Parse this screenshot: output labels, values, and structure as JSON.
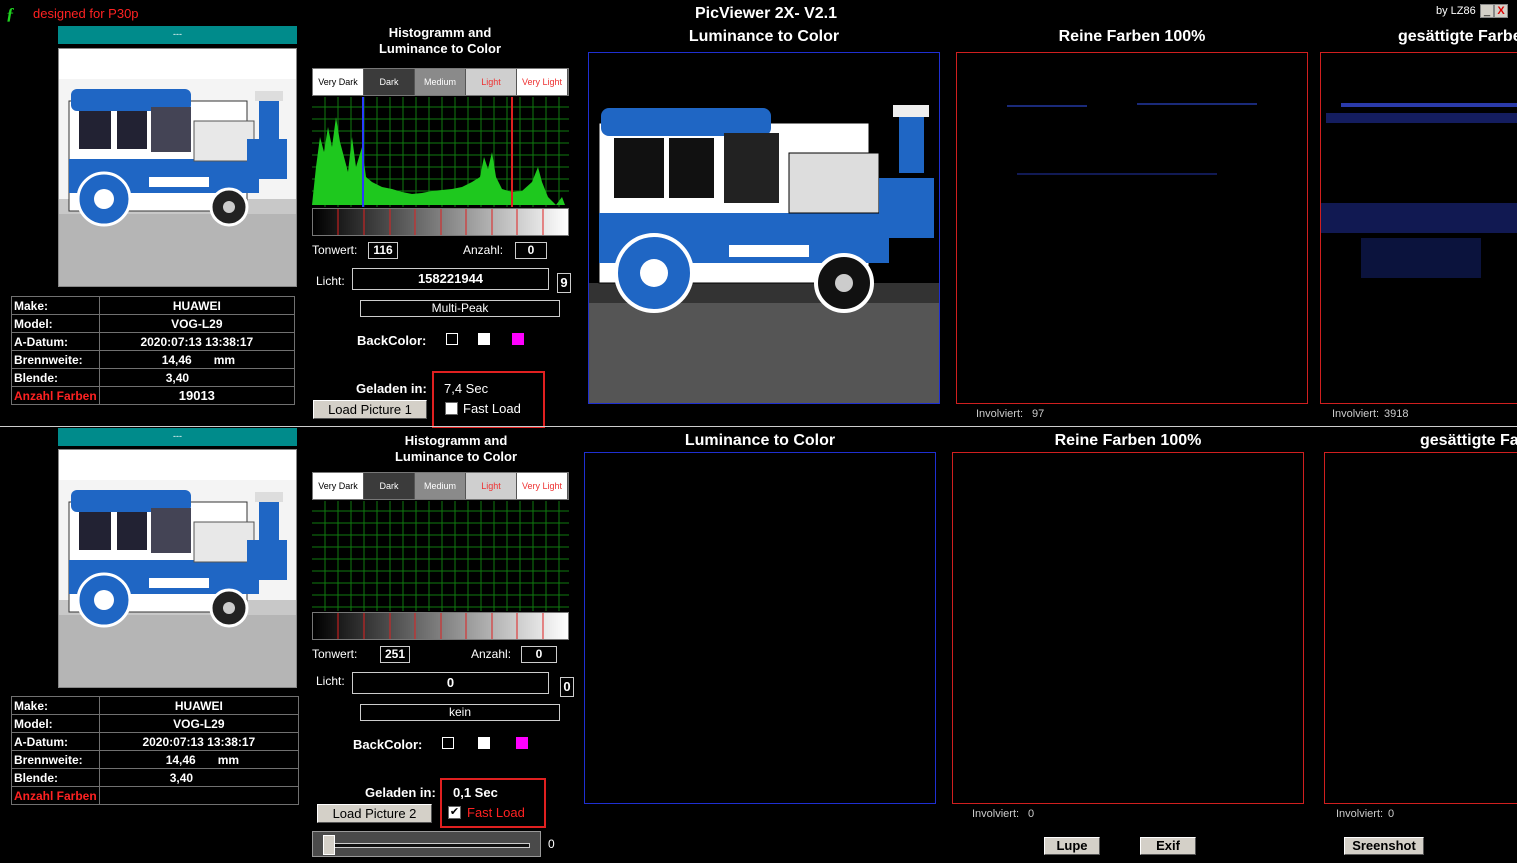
{
  "app": {
    "logo": "ƒ",
    "designed_for": "designed for P30p",
    "title": "PicViewer 2X- V2.1",
    "by": "by LZ86",
    "minimize": "_",
    "close": "X"
  },
  "panel1": {
    "thumb_bar": "---",
    "exif": {
      "make_label": "Make:",
      "make": "HUAWEI",
      "model_label": "Model:",
      "model": "VOG-L29",
      "date_label": "A-Datum:",
      "date": "2020:07:13 13:38:17",
      "focal_label": "Brennweite:",
      "focal": "14,46",
      "focal_unit": "mm",
      "aperture_label": "Blende:",
      "aperture": "3,40",
      "colors_label": "Anzahl Farben",
      "colors": "19013"
    },
    "hist_title": "Histogramm and\nLuminance to Color",
    "tones": [
      "Very Dark",
      "Dark",
      "Medium",
      "Light",
      "Very Light"
    ],
    "tonwert_label": "Tonwert:",
    "tonwert": "116",
    "anzahl_label": "Anzahl:",
    "anzahl": "0",
    "licht_label": "Licht:",
    "licht": "158221944",
    "licht_idx": "9",
    "mode": "Multi-Peak",
    "backcolor_label": "BackColor:",
    "geladen_label": "Geladen in:",
    "geladen": "7,4 Sec",
    "fastload_label": "Fast Load",
    "fastload_checked": false,
    "load_button": "Load Picture 1",
    "lum_title": "Luminance to Color",
    "reine_title": "Reine Farben 100%",
    "sat_title": "gesättigte Farben",
    "involviert_label": "Involviert:",
    "involviert_reine": "97",
    "involviert_sat": "3918"
  },
  "panel2": {
    "thumb_bar": "---",
    "exif": {
      "make_label": "Make:",
      "make": "HUAWEI",
      "model_label": "Model:",
      "model": "VOG-L29",
      "date_label": "A-Datum:",
      "date": "2020:07:13 13:38:17",
      "focal_label": "Brennweite:",
      "focal": "14,46",
      "focal_unit": "mm",
      "aperture_label": "Blende:",
      "aperture": "3,40",
      "colors_label": "Anzahl Farben",
      "colors": ""
    },
    "hist_title": "Histogramm and\nLuminance to Color",
    "tones": [
      "Very Dark",
      "Dark",
      "Medium",
      "Light",
      "Very Light"
    ],
    "tonwert_label": "Tonwert:",
    "tonwert": "251",
    "anzahl_label": "Anzahl:",
    "anzahl": "0",
    "licht_label": "Licht:",
    "licht": "0",
    "licht_idx": "0",
    "mode": "kein",
    "backcolor_label": "BackColor:",
    "geladen_label": "Geladen in:",
    "geladen": "0,1 Sec",
    "fastload_label": "Fast Load",
    "fastload_checked": true,
    "load_button": "Load Picture 2",
    "lum_title": "Luminance to Color",
    "reine_title": "Reine Farben 100%",
    "sat_title": "gesättigte Farben",
    "involviert_label": "Involviert:",
    "involviert_reine": "0",
    "involviert_sat": "0",
    "slider_value": "0"
  },
  "bottom": {
    "lupe": "Lupe",
    "exif": "Exif",
    "screenshot": "Sreenshot"
  },
  "colors": {
    "accent_teal": "#008b8b",
    "frame_blue": "#1f2fd1",
    "frame_red": "#d01f1f",
    "histogram": "#1ec81e",
    "magenta": "#ff00ff"
  }
}
